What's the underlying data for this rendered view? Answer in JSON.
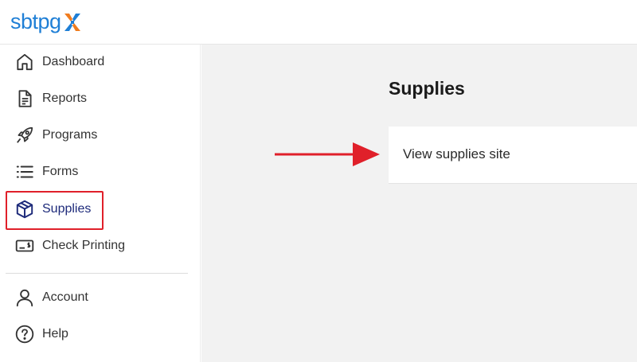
{
  "brand": {
    "logo_text": "sbtpg",
    "accent_blue": "#1f7fd6",
    "accent_orange": "#f07c1e"
  },
  "sidebar": {
    "items": [
      {
        "label": "Dashboard",
        "icon": "home-icon"
      },
      {
        "label": "Reports",
        "icon": "document-icon"
      },
      {
        "label": "Programs",
        "icon": "rocket-icon"
      },
      {
        "label": "Forms",
        "icon": "list-icon"
      },
      {
        "label": "Supplies",
        "icon": "box-icon",
        "active": true
      },
      {
        "label": "Check Printing",
        "icon": "check-icon"
      },
      {
        "label": "Account",
        "icon": "user-icon"
      },
      {
        "label": "Help",
        "icon": "help-icon"
      }
    ]
  },
  "main": {
    "title": "Supplies",
    "card_link": "View supplies site"
  },
  "annotation": {
    "color": "#e0202a"
  }
}
